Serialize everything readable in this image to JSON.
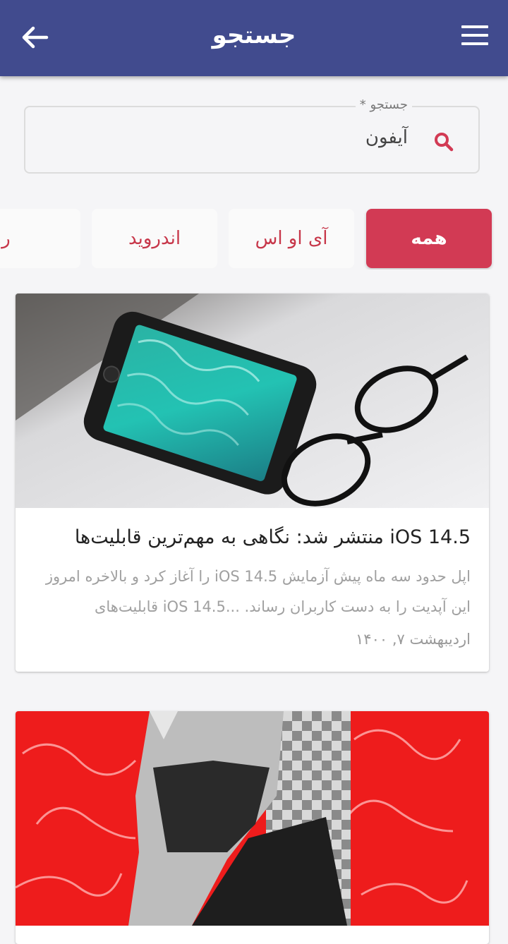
{
  "appbar": {
    "title": "جستجو",
    "back_icon": "arrow-left-icon",
    "menu_icon": "hamburger-menu-icon"
  },
  "search": {
    "label": "جستجو *",
    "value": "آیفون",
    "icon": "search-icon"
  },
  "filters": {
    "chips": [
      {
        "label": "همه",
        "active": true
      },
      {
        "label": "آی او اس",
        "active": false
      },
      {
        "label": "اندروید",
        "active": false
      },
      {
        "label": "روباتیک",
        "active": false
      }
    ]
  },
  "articles": [
    {
      "headline": "iOS 14.5 منتشر شد: نگاهی به مهم‌ترین قابلیت‌ها",
      "excerpt": "اپل حدود سه ماه پیش آزمایش iOS 14.5 را آغاز کرد و بالاخره امروز این آپدیت را به دست کاربران رساند. ...iOS 14.5 قابلیت‌های",
      "date": "اردیبهشت ۷, ۱۴۰۰"
    },
    {
      "headline": "",
      "excerpt": "",
      "date": ""
    }
  ],
  "colors": {
    "appbar": "#414b8e",
    "accent": "#d23a54",
    "chip_text": "#c7374a"
  }
}
